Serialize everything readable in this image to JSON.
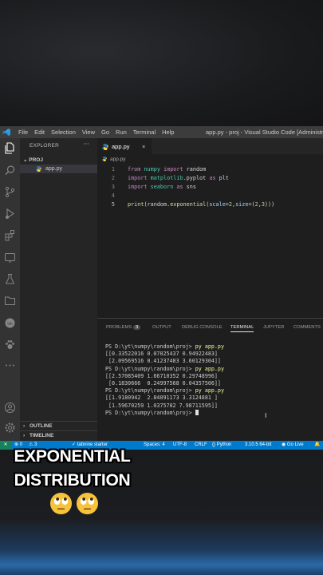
{
  "window": {
    "menu": [
      "File",
      "Edit",
      "Selection",
      "View",
      "Go",
      "Run",
      "Terminal",
      "Help"
    ],
    "title": "app.py - proj - Visual Studio Code [Administrato"
  },
  "sidebar": {
    "header": "EXPLORER",
    "more": "···",
    "project": "PROJ",
    "file": "app.py",
    "outline": "OUTLINE",
    "timeline": "TIMELINE"
  },
  "tab": {
    "label": "app.py",
    "close": "×"
  },
  "breadcrumb": "app.py",
  "editor": {
    "line_numbers": [
      "1",
      "2",
      "3",
      "4",
      "5"
    ],
    "lines": [
      "from numpy import random",
      "import matplotlib.pyplot as plt",
      "import seaborn as sns",
      "",
      "print(random.exponential(scale=2,size=(2,3)))"
    ]
  },
  "panel": {
    "tabs": [
      "PROBLEMS",
      "OUTPUT",
      "DEBUG CONSOLE",
      "TERMINAL",
      "JUPYTER",
      "COMMENTS"
    ],
    "problems_count": "3",
    "active_tab": "TERMINAL"
  },
  "terminal": {
    "prompt": "PS D:\\yt\\numpy\\random\\proj> ",
    "command": "py app.py",
    "runs": [
      [
        "[[0.33522016 0.07025437 0.94922483]",
        " [2.09569516 0.41237483 3.60129304]]"
      ],
      [
        "[[2.57085409 1.66710352 0.29748996]",
        " [0.1830666  0.24997568 0.04357506]]"
      ],
      [
        "[[1.9180942  2.84091173 3.3124881 ]",
        " [1.59670259 1.0375702 7.98711595]]"
      ]
    ]
  },
  "statusbar": {
    "errors": "⊗ 0",
    "warnings": "⚠ 3",
    "tabnine": "tabnine starter",
    "spaces": "Spaces: 4",
    "encoding": "UTF-8",
    "eol": "CRLF",
    "language": "Python",
    "interpreter": "3.10.5 64-bit",
    "golive": "Go Live"
  },
  "caption": {
    "line1": "EXPONENTIAL",
    "line2": "DISTRIBUTION",
    "emoji": "face-with-rolling-eyes"
  },
  "colors": {
    "statusbar": "#007acc",
    "titlebar": "#3c3c3c",
    "activitybar": "#333333",
    "sidebar": "#252526",
    "editor": "#1e1e1e"
  }
}
